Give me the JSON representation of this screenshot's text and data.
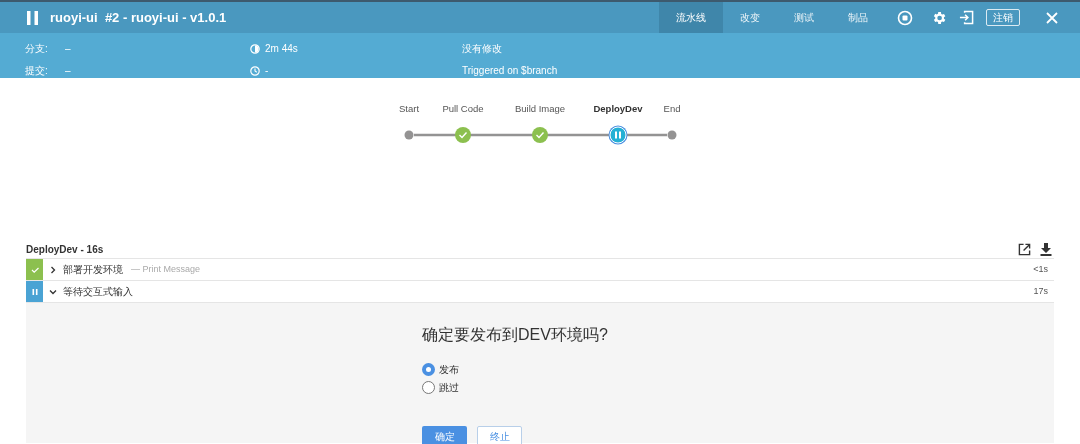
{
  "header": {
    "paused": true,
    "title": "ruoyi-ui  #2 - ruoyi-ui - v1.0.1",
    "tabs": [
      {
        "label": "流水线",
        "selected": true
      },
      {
        "label": "改变",
        "selected": false
      },
      {
        "label": "测试",
        "selected": false
      },
      {
        "label": "制品",
        "selected": false
      }
    ],
    "logout": "注销"
  },
  "info": {
    "branch_label": "分支:",
    "branch": "–",
    "commit_label": "提交:",
    "commit": "–",
    "duration": "2m 44s",
    "started": "-",
    "changes": "没有修改",
    "cause": "Triggered on $branch"
  },
  "pipeline": {
    "stages": [
      {
        "name": "Start",
        "kind": "start",
        "selected": false
      },
      {
        "name": "Pull Code",
        "kind": "success",
        "selected": false
      },
      {
        "name": "Build Image",
        "kind": "success",
        "selected": false
      },
      {
        "name": "DeployDev",
        "kind": "paused",
        "selected": true
      },
      {
        "name": "End",
        "kind": "end",
        "selected": false
      }
    ]
  },
  "steps": {
    "title": "DeployDev - 16s",
    "items": [
      {
        "kind": "success",
        "name": "部署开发环境",
        "detail": "— Print Message",
        "expanded": false,
        "duration": "<1s"
      },
      {
        "kind": "paused",
        "name": "等待交互式输入",
        "expanded": true,
        "duration": "17s"
      }
    ]
  },
  "input": {
    "question": "确定要发布到DEV环境吗?",
    "options": [
      {
        "label": "发布",
        "selected": true
      },
      {
        "label": "跳过",
        "selected": false
      }
    ],
    "buttons": [
      {
        "label": "确定",
        "kind": "primary"
      },
      {
        "label": "终止",
        "kind": "secondary"
      }
    ]
  }
}
